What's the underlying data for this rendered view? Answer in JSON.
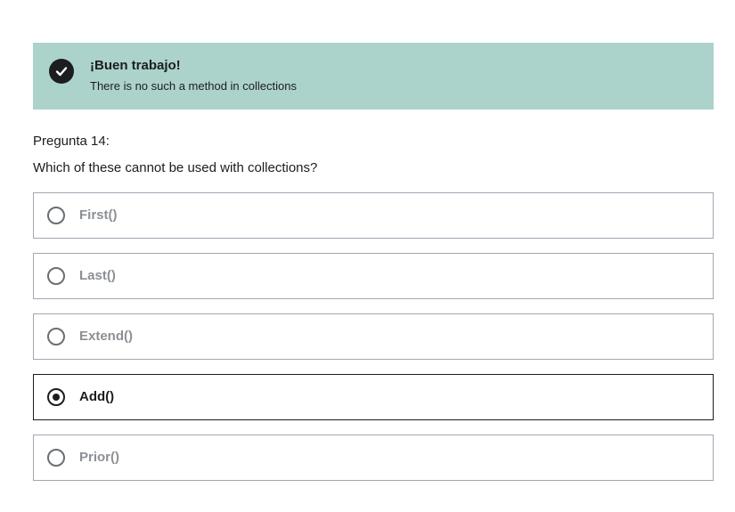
{
  "feedback": {
    "icon": "checkmark-icon",
    "title": "¡Buen trabajo!",
    "message": "There is no such a method in collections",
    "background_color": "#acd2cc"
  },
  "question": {
    "number_label": "Pregunta 14:",
    "text": "Which of these cannot be used with collections?"
  },
  "answers": [
    {
      "label": "First()",
      "selected": false
    },
    {
      "label": "Last()",
      "selected": false
    },
    {
      "label": "Extend()",
      "selected": false
    },
    {
      "label": "Add()",
      "selected": true
    },
    {
      "label": "Prior()",
      "selected": false
    }
  ]
}
